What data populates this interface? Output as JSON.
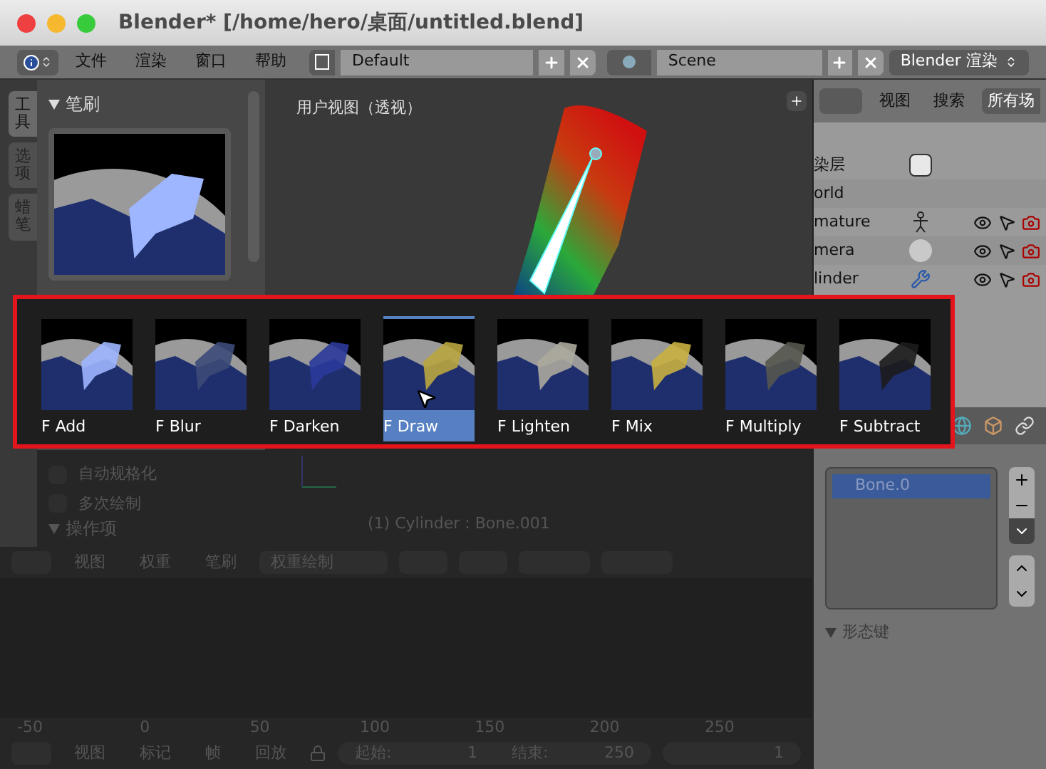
{
  "window": {
    "title": "Blender* [/home/hero/桌面/untitled.blend]"
  },
  "menu_bar": {
    "menus": [
      "文件",
      "渲染",
      "窗口",
      "帮助"
    ],
    "layout": "Default",
    "scene": "Scene",
    "engine": "Blender 渲染"
  },
  "tool_shelf": {
    "tabs": [
      {
        "label": "工具",
        "selected": true
      },
      {
        "label": "选项",
        "selected": false
      },
      {
        "label": "蜡笔",
        "selected": false
      }
    ],
    "panel_title": "笔刷",
    "options": [
      {
        "label": "自动规格化",
        "checked": false
      },
      {
        "label": "多次绘制",
        "checked": false
      }
    ],
    "operator_panel": "操作项"
  },
  "viewport": {
    "label": "用户视图（透视）",
    "object_info": "(1) Cylinder : Bone.001"
  },
  "brush_popup": {
    "items": [
      {
        "label": "F Add",
        "color": "#9db6ff",
        "selected": false
      },
      {
        "label": "F Blur",
        "color": "#3c4a78",
        "selected": false
      },
      {
        "label": "F Darken",
        "color": "#2a3a9a",
        "selected": false
      },
      {
        "label": "F Draw",
        "color": "#b9a63f",
        "selected": true
      },
      {
        "label": "F Lighten",
        "color": "#aca89c",
        "selected": false
      },
      {
        "label": "F Mix",
        "color": "#c8b040",
        "selected": false
      },
      {
        "label": "F Multiply",
        "color": "#55564e",
        "selected": false
      },
      {
        "label": "F Subtract",
        "color": "#1c1c1c",
        "selected": false
      }
    ]
  },
  "outliner": {
    "menus": [
      "视图",
      "搜索"
    ],
    "filter": "所有场",
    "rows": [
      {
        "name": "染层",
        "kind": "layer"
      },
      {
        "name": "orld",
        "kind": "world"
      },
      {
        "name": "mature",
        "kind": "armature"
      },
      {
        "name": "mera",
        "kind": "camera"
      },
      {
        "name": "linder",
        "kind": "mesh"
      }
    ]
  },
  "properties": {
    "vertex_group": "Bone.0",
    "shape_keys_panel": "形态键"
  },
  "view3d_header": {
    "menus": [
      "视图",
      "权重",
      "笔刷"
    ],
    "mode": "权重绘制"
  },
  "timeline": {
    "ticks": [
      "-50",
      "0",
      "50",
      "100",
      "150",
      "200",
      "250"
    ]
  },
  "timeline_header": {
    "menus": [
      "视图",
      "标记",
      "帧",
      "回放"
    ],
    "start_label": "起始:",
    "start": "1",
    "end_label": "结束:",
    "end": "250",
    "current": "1"
  }
}
